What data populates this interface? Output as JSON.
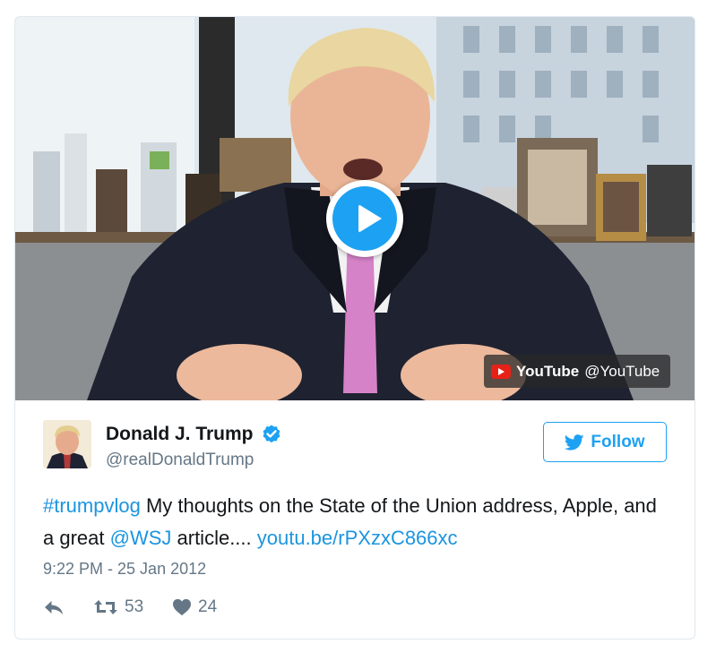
{
  "video": {
    "attribution_brand": "YouTube",
    "attribution_handle": "@YouTube"
  },
  "tweet": {
    "author_name": "Donald J. Trump",
    "author_handle": "@realDonaldTrump",
    "verified": true,
    "follow_label": "Follow",
    "text": {
      "hashtag": "#trumpvlog",
      "part1": " My thoughts on the State of the Union address, Apple, and a great ",
      "mention": "@WSJ",
      "part2": " article.... ",
      "link": "youtu.be/rPXzxC866xc"
    },
    "timestamp": "9:22 PM - 25 Jan 2012",
    "retweet_count": "53",
    "like_count": "24"
  },
  "colors": {
    "accent": "#1da1f2",
    "link": "#1b95e0",
    "muted": "#657786",
    "youtube_red": "#e62117"
  }
}
